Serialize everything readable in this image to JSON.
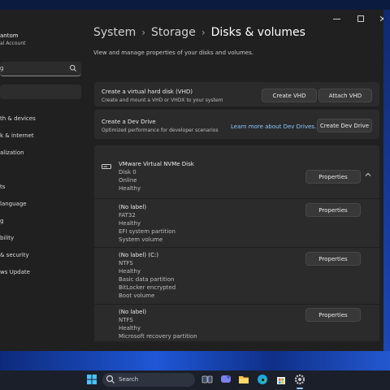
{
  "window": {
    "controls": {
      "minimize": "minimize",
      "maximize": "maximize",
      "close": "✕"
    }
  },
  "sidebar": {
    "profile_name": "antom",
    "profile_sub": "al Account",
    "search_value": "g",
    "items": [
      {
        "label": "th & devices"
      },
      {
        "label": "k & internet"
      },
      {
        "label": "alization"
      },
      {
        "label": "ts"
      },
      {
        "label": "language"
      },
      {
        "label": "g"
      },
      {
        "label": "bility"
      },
      {
        "label": "& security"
      },
      {
        "label": "ws Update"
      }
    ]
  },
  "header": {
    "breadcrumb": [
      "System",
      "Storage",
      "Disks & volumes"
    ],
    "separator": "›",
    "subtitle": "View and manage properties of your disks and volumes."
  },
  "vhd_card": {
    "title": "Create a virtual hard disk (VHD)",
    "description": "Create and mount a VHD or VHDX to your system",
    "create_label": "Create VHD",
    "attach_label": "Attach VHD"
  },
  "devdrive_card": {
    "title": "Create a Dev Drive",
    "description": "Optimized performance for developer scenarios",
    "learn_more": "Learn more about Dev Drives.",
    "create_label": "Create Dev Drive"
  },
  "disk": {
    "name": "VMware Virtual NVMe Disk",
    "details": [
      "Disk 0",
      "Online",
      "Healthy"
    ],
    "properties_label": "Properties",
    "volumes": [
      {
        "label": "(No label)",
        "details": [
          "FAT32",
          "Healthy",
          "EFI system partition",
          "System volume"
        ],
        "properties_label": "Properties"
      },
      {
        "label": "(No label) (C:)",
        "details": [
          "NTFS",
          "Healthy",
          "Basic data partition",
          "BitLocker encrypted",
          "Boot volume"
        ],
        "properties_label": "Properties"
      },
      {
        "label": "(No label)",
        "details": [
          "NTFS",
          "Healthy",
          "Microsoft recovery partition"
        ],
        "properties_label": "Properties"
      }
    ]
  },
  "taskbar": {
    "search_label": "Search",
    "icons": [
      "windows-start-icon",
      "search-icon",
      "task-view-icon",
      "teams-chat-icon",
      "file-explorer-icon",
      "edge-browser-icon",
      "microsoft-store-icon",
      "settings-icon"
    ]
  }
}
